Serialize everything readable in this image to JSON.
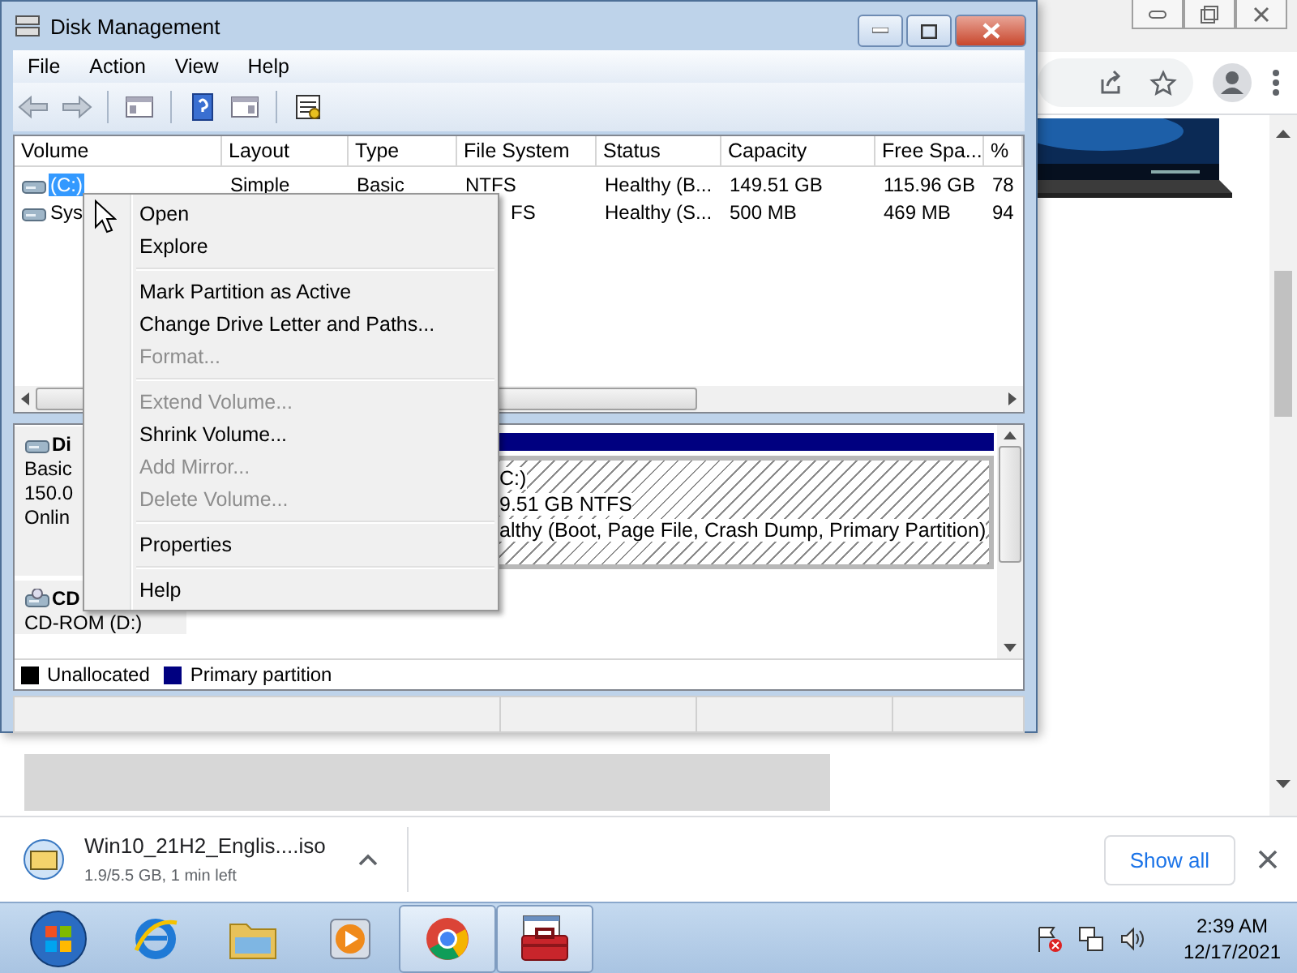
{
  "browser": {
    "download": {
      "file_name": "Win10_21H2_Englis....iso",
      "progress": "1.9/5.5 GB, 1 min left",
      "show_all": "Show all"
    }
  },
  "disk_management": {
    "title": "Disk Management",
    "menu": [
      "File",
      "Action",
      "View",
      "Help"
    ],
    "volumes": {
      "columns": [
        "Volume",
        "Layout",
        "Type",
        "File System",
        "Status",
        "Capacity",
        "Free Spa...",
        "%"
      ],
      "rows": [
        {
          "selected": true,
          "cells": [
            "(C:)",
            "Simple",
            "Basic",
            "NTFS",
            "Healthy (B...",
            "149.51 GB",
            "115.96 GB",
            "78"
          ]
        },
        {
          "selected": false,
          "cells": [
            "Sys",
            null,
            null,
            "FS",
            "Healthy (S...",
            "500 MB",
            "469 MB",
            "94"
          ]
        }
      ]
    },
    "disks": [
      {
        "kind": "hard",
        "name": "Di",
        "lines": [
          "Basic",
          "150.0",
          "Onlin"
        ],
        "partitions": [
          {
            "selected": true,
            "lines": [
              "C:)",
              "9.51 GB NTFS",
              "althy (Boot, Page File, Crash Dump, Primary Partition)"
            ]
          }
        ]
      },
      {
        "kind": "cdrom",
        "name": "CD",
        "lines": [
          "CD-ROM (D:)"
        ]
      }
    ],
    "legend": [
      {
        "label": "Unallocated",
        "color": "#000000"
      },
      {
        "label": "Primary partition",
        "color": "#000080"
      }
    ],
    "context_menu": [
      {
        "kind": "item",
        "label": "Open",
        "disabled": false
      },
      {
        "kind": "item",
        "label": "Explore",
        "disabled": false
      },
      {
        "kind": "separator"
      },
      {
        "kind": "item",
        "label": "Mark Partition as Active",
        "disabled": false
      },
      {
        "kind": "item",
        "label": "Change Drive Letter and Paths...",
        "disabled": false
      },
      {
        "kind": "item",
        "label": "Format...",
        "disabled": true
      },
      {
        "kind": "separator"
      },
      {
        "kind": "item",
        "label": "Extend Volume...",
        "disabled": true
      },
      {
        "kind": "item",
        "label": "Shrink Volume...",
        "disabled": false
      },
      {
        "kind": "item",
        "label": "Add Mirror...",
        "disabled": true
      },
      {
        "kind": "item",
        "label": "Delete Volume...",
        "disabled": true
      },
      {
        "kind": "separator"
      },
      {
        "kind": "item",
        "label": "Properties",
        "disabled": false
      },
      {
        "kind": "separator"
      },
      {
        "kind": "item",
        "label": "Help",
        "disabled": false
      }
    ]
  },
  "taskbar": {
    "apps": [
      {
        "kind": "start",
        "active": false
      },
      {
        "kind": "ie",
        "active": false
      },
      {
        "kind": "folder",
        "active": false
      },
      {
        "kind": "media",
        "active": false
      },
      {
        "kind": "chrome",
        "active": true
      },
      {
        "kind": "toolbox",
        "active": true
      }
    ],
    "clock": {
      "time": "2:39 AM",
      "date": "12/17/2021"
    }
  }
}
